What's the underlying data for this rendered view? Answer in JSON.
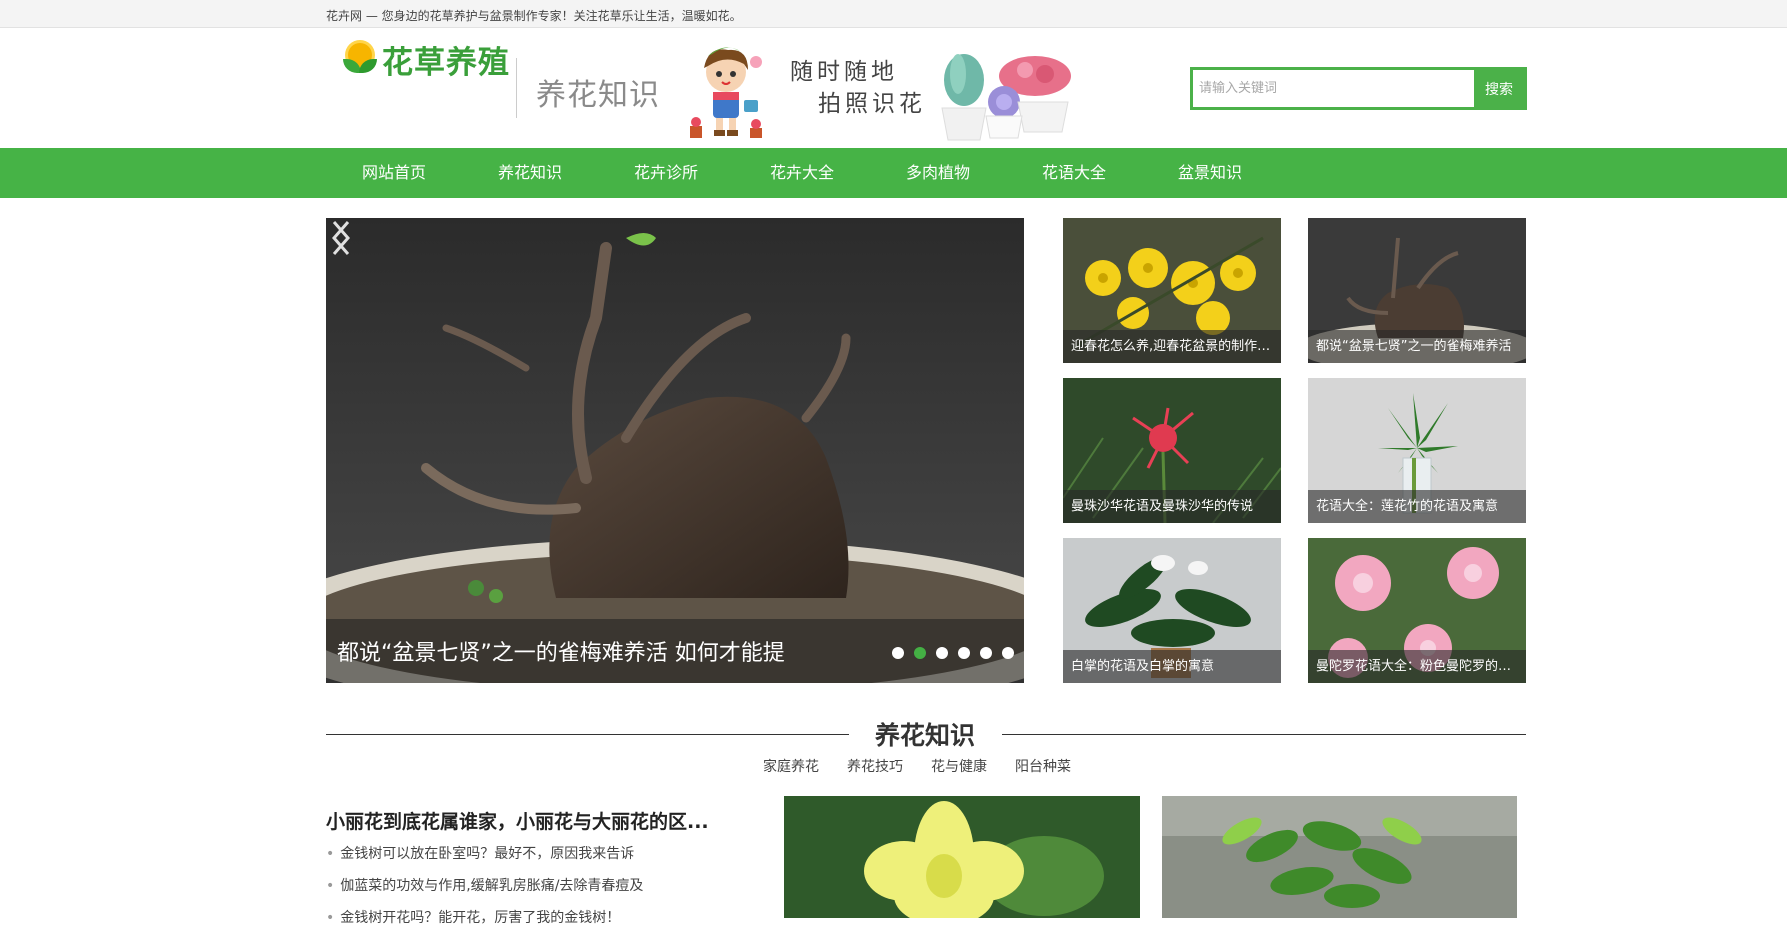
{
  "topbar": {
    "text": "花卉网 — 您身边的花草养护与盆景制作专家！关注花草乐让生活，温暖如花。"
  },
  "header": {
    "logo_text": "花草养殖",
    "sub_title": "养花知识",
    "banner_line1": "随时随地",
    "banner_line2": "拍照识花"
  },
  "search": {
    "placeholder": "请输入关键词",
    "button_label": "搜索"
  },
  "nav": {
    "items": [
      {
        "label": "网站首页"
      },
      {
        "label": "养花知识"
      },
      {
        "label": "花卉诊所"
      },
      {
        "label": "花卉大全"
      },
      {
        "label": "多肉植物"
      },
      {
        "label": "花语大全"
      },
      {
        "label": "盆景知识"
      }
    ]
  },
  "slider": {
    "caption": "都说“盆景七贤”之一的雀梅难养活 如何才能提",
    "dot_count": 6,
    "active_dot": 2
  },
  "thumbs": [
    {
      "caption": "迎春花怎么养,迎春花盆景的制作方法"
    },
    {
      "caption": "都说“盆景七贤”之一的雀梅难养活"
    },
    {
      "caption": "曼珠沙华花语及曼珠沙华的传说"
    },
    {
      "caption": "花语大全：莲花竹的花语及寓意"
    },
    {
      "caption": "白掌的花语及白掌的寓意"
    },
    {
      "caption": "曼陀罗花语大全：粉色曼陀罗的花语"
    }
  ],
  "section": {
    "title": "养花知识",
    "tabs": [
      "家庭养花",
      "养花技巧",
      "花与健康",
      "阳台种菜"
    ]
  },
  "article": {
    "headline": "小丽花到底花属谁家，小丽花与大丽花的区...",
    "items": [
      "金钱树可以放在卧室吗？最好不，原因我来告诉",
      "伽蓝菜的功效与作用,缓解乳房胀痛/去除青春痘及",
      "金钱树开花吗？能开花，厉害了我的金钱树！"
    ]
  }
}
